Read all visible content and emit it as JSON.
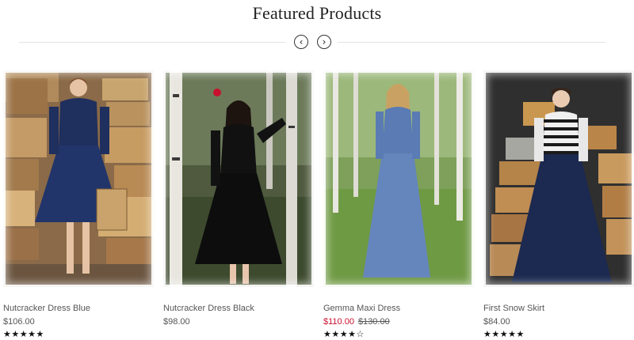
{
  "section": {
    "title": "Featured Products"
  },
  "nav": {
    "prev_icon": "‹",
    "next_icon": "›"
  },
  "products": [
    {
      "name": "Nutcracker Dress Blue",
      "price": "$106.00",
      "old_price": "",
      "rating": 5,
      "stars": "★★★★★"
    },
    {
      "name": "Nutcracker Dress Black",
      "price": "$98.00",
      "old_price": "",
      "rating": 0,
      "stars": ""
    },
    {
      "name": "Gemma Maxi Dress",
      "price": "$110.00",
      "old_price": "$130.00",
      "rating": 4,
      "stars": "★★★★☆"
    },
    {
      "name": "First Snow Skirt",
      "price": "$84.00",
      "old_price": "",
      "rating": 5,
      "stars": "★★★★★"
    }
  ],
  "colors": {
    "sale": "#c8102e",
    "text": "#555555",
    "title": "#222222"
  }
}
